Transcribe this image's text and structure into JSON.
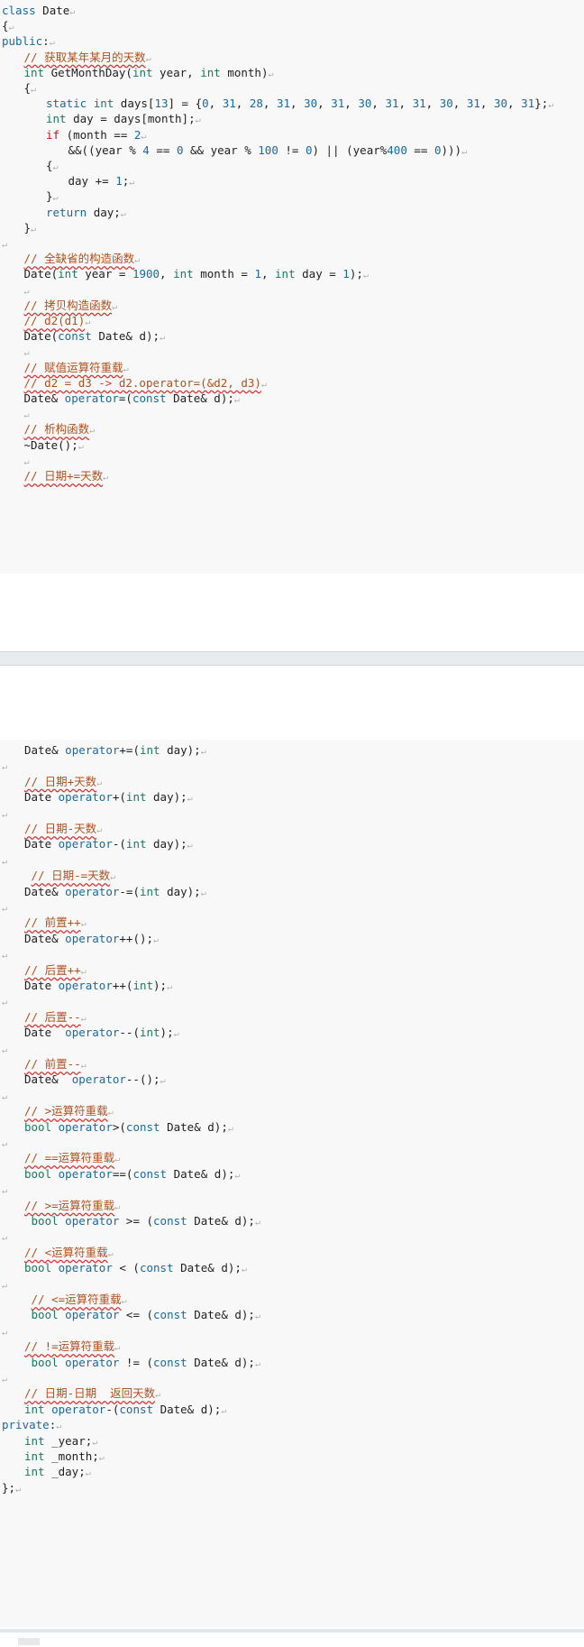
{
  "block1_lines": [
    {
      "i": 0,
      "t": "class Date"
    },
    {
      "i": 0,
      "t": "{"
    },
    {
      "i": 0,
      "t": "public:"
    },
    {
      "i": 1,
      "t": "// 获取某年某月的天数"
    },
    {
      "i": 1,
      "t": "int GetMonthDay(int year, int month)"
    },
    {
      "i": 1,
      "t": "{"
    },
    {
      "i": 2,
      "t": "static int days[13] = {0, 31, 28, 31, 30, 31, 30, 31, 31, 30, 31, 30, 31};"
    },
    {
      "i": 2,
      "t": "int day = days[month];"
    },
    {
      "i": 2,
      "t": "if (month == 2"
    },
    {
      "i": 3,
      "t": "&&((year % 4 == 0 && year % 100 != 0) || (year%400 == 0)))"
    },
    {
      "i": 2,
      "t": "{"
    },
    {
      "i": 3,
      "t": "day += 1;"
    },
    {
      "i": 2,
      "t": "}"
    },
    {
      "i": 2,
      "t": "return day;"
    },
    {
      "i": 1,
      "t": "}"
    },
    {
      "i": 0,
      "t": ""
    },
    {
      "i": 1,
      "t": "// 全缺省的构造函数"
    },
    {
      "i": 1,
      "t": "Date(int year = 1900, int month = 1, int day = 1);"
    },
    {
      "i": 1,
      "t": ""
    },
    {
      "i": 1,
      "t": "// 拷贝构造函数"
    },
    {
      "i": 1,
      "t": "// d2(d1)"
    },
    {
      "i": 1,
      "t": "Date(const Date& d);"
    },
    {
      "i": 1,
      "t": ""
    },
    {
      "i": 1,
      "t": "// 赋值运算符重载"
    },
    {
      "i": 1,
      "t": "// d2 = d3 -> d2.operator=(&d2, d3)"
    },
    {
      "i": 1,
      "t": "Date& operator=(const Date& d);"
    },
    {
      "i": 1,
      "t": ""
    },
    {
      "i": 1,
      "t": "// 析构函数"
    },
    {
      "i": 1,
      "t": "~Date();"
    },
    {
      "i": 1,
      "t": ""
    },
    {
      "i": 1,
      "t": "// 日期+=天数"
    }
  ],
  "block2_lines": [
    {
      "i": 1,
      "t": "Date& operator+=(int day);"
    },
    {
      "i": 0,
      "t": ""
    },
    {
      "i": 1,
      "t": "// 日期+天数"
    },
    {
      "i": 1,
      "t": "Date operator+(int day);"
    },
    {
      "i": 0,
      "t": ""
    },
    {
      "i": 1,
      "t": "// 日期-天数"
    },
    {
      "i": 1,
      "t": "Date operator-(int day);"
    },
    {
      "i": 0,
      "t": ""
    },
    {
      "i": 1,
      "t": " // 日期-=天数"
    },
    {
      "i": 1,
      "t": "Date& operator-=(int day);"
    },
    {
      "i": 0,
      "t": ""
    },
    {
      "i": 1,
      "t": "// 前置++"
    },
    {
      "i": 1,
      "t": "Date& operator++();"
    },
    {
      "i": 0,
      "t": ""
    },
    {
      "i": 1,
      "t": "// 后置++"
    },
    {
      "i": 1,
      "t": "Date operator++(int);"
    },
    {
      "i": 0,
      "t": ""
    },
    {
      "i": 1,
      "t": "// 后置--"
    },
    {
      "i": 1,
      "t": "Date  operator--(int);"
    },
    {
      "i": 0,
      "t": ""
    },
    {
      "i": 1,
      "t": "// 前置--"
    },
    {
      "i": 1,
      "t": "Date&  operator--();"
    },
    {
      "i": 0,
      "t": ""
    },
    {
      "i": 1,
      "t": "// >运算符重载"
    },
    {
      "i": 1,
      "t": "bool operator>(const Date& d);"
    },
    {
      "i": 0,
      "t": ""
    },
    {
      "i": 1,
      "t": "// ==运算符重载"
    },
    {
      "i": 1,
      "t": "bool operator==(const Date& d);"
    },
    {
      "i": 0,
      "t": ""
    },
    {
      "i": 1,
      "t": "// >=运算符重载"
    },
    {
      "i": 1,
      "t": " bool operator >= (const Date& d);"
    },
    {
      "i": 0,
      "t": ""
    },
    {
      "i": 1,
      "t": "// <运算符重载"
    },
    {
      "i": 1,
      "t": "bool operator < (const Date& d);"
    },
    {
      "i": 0,
      "t": ""
    },
    {
      "i": 1,
      "t": " // <=运算符重载"
    },
    {
      "i": 1,
      "t": " bool operator <= (const Date& d);"
    },
    {
      "i": 0,
      "t": ""
    },
    {
      "i": 1,
      "t": "// !=运算符重载"
    },
    {
      "i": 1,
      "t": " bool operator != (const Date& d);"
    },
    {
      "i": 0,
      "t": ""
    },
    {
      "i": 1,
      "t": "// 日期-日期  返回天数"
    },
    {
      "i": 1,
      "t": "int operator-(const Date& d);"
    },
    {
      "i": 0,
      "t": "private:"
    },
    {
      "i": 1,
      "t": "int _year;"
    },
    {
      "i": 1,
      "t": "int _month;"
    },
    {
      "i": 1,
      "t": "int _day;"
    },
    {
      "i": 0,
      "t": "};"
    }
  ]
}
